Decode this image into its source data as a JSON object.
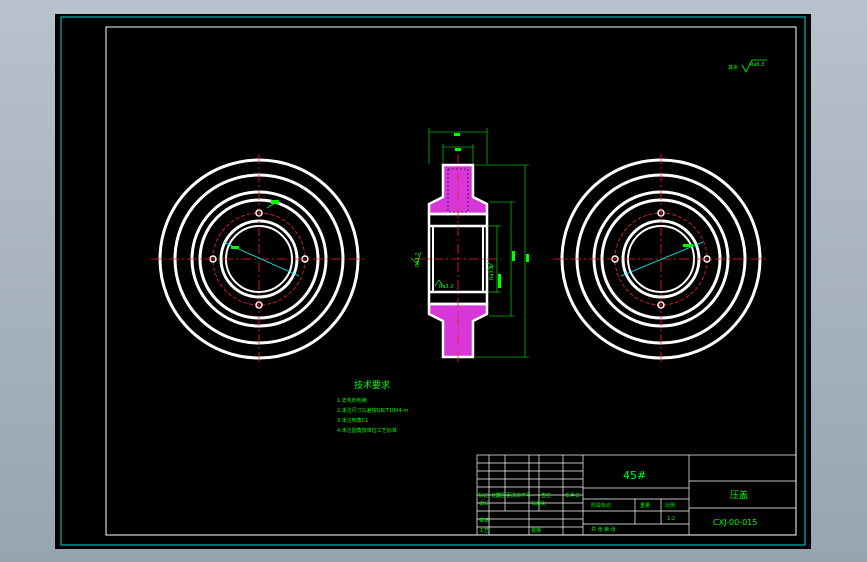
{
  "colors": {
    "background": "#000000",
    "frame": "#00d7d7",
    "part": "#ffffff",
    "centerline": "#ff2020",
    "dimension": "#00ff00",
    "hatch": "#ff40ff",
    "annotation": "#00ff00",
    "title_block_text": "#00ff00",
    "title_block_lines": "#ffffff"
  },
  "roughness": {
    "corner_symbol": "Ra6.3",
    "left_bore": "Ra3.2",
    "right_face": "Ra3.2",
    "left_face": "Ra3.2"
  },
  "tech_requirements": {
    "title": "技术要求",
    "items": [
      "1.去毛刺毛棱",
      "2.未注尺寸公差按GB/T1804-m",
      "3.未注倒角C1",
      "4.未注圆角按单位工艺标准"
    ]
  },
  "title_block": {
    "material": "45#",
    "part_name": "压盖",
    "drawing_no": "CXJ-00-015",
    "scale": "1:2",
    "row_labels": [
      "标记",
      "处数",
      "分区",
      "更改文件号",
      "签名",
      "年月日"
    ],
    "design_label": "设计",
    "standard_label": "标准化",
    "review_label": "审核",
    "process_label": "工艺",
    "approve_label": "批准",
    "stage_label": "阶段标记",
    "weight_label": "重量",
    "scale_label": "比例",
    "sheets_label": "共 张 第 张"
  }
}
